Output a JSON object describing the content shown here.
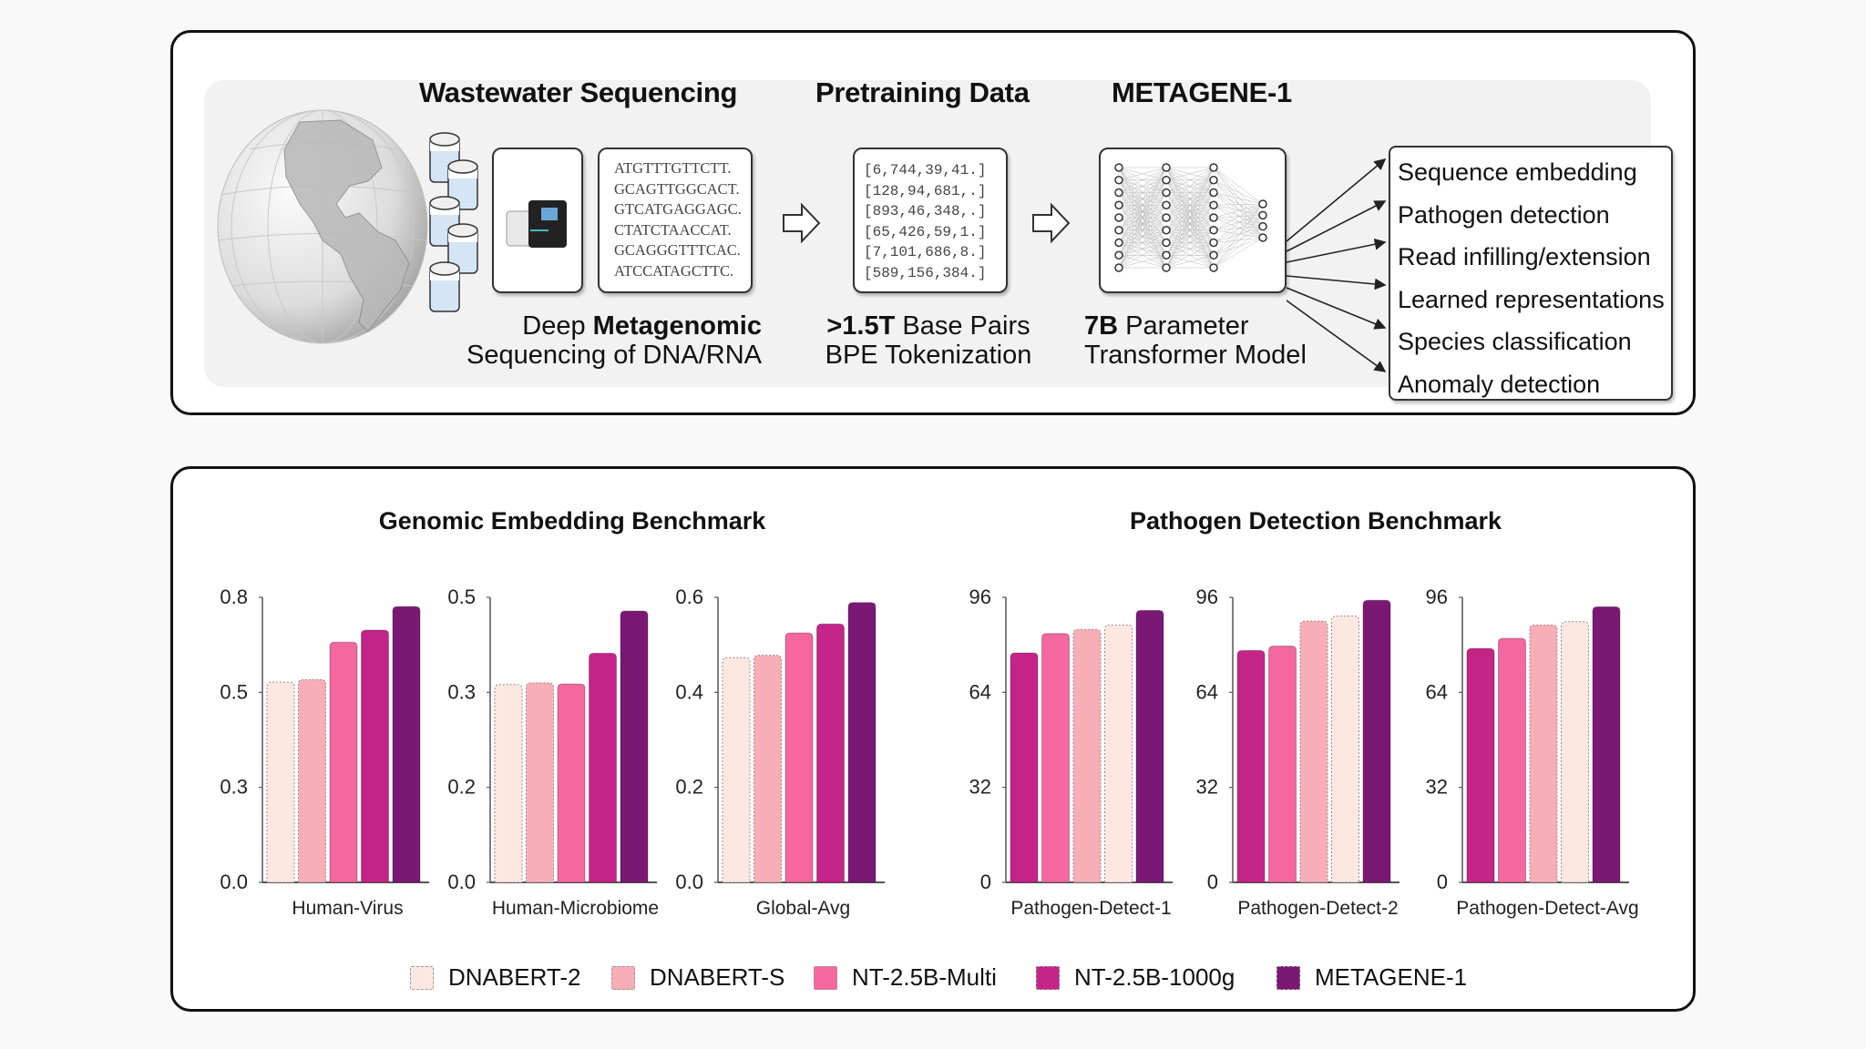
{
  "pipeline": {
    "stage1": {
      "title": "Wastewater Sequencing",
      "caption_bold": "Metagenomic",
      "caption_pre": "Deep ",
      "caption_line2": "Sequencing of DNA/RNA",
      "sequences": [
        "ATGTTTGTTCTT.",
        "GCAGTTGGCACT.",
        "GTCATGAGGAGC.",
        "CTATCTAACCAT.",
        "GCAGGGTTTCAC.",
        "ATCCATAGCTTC."
      ],
      "icons": [
        "globe-icon",
        "sample-tube-icon",
        "sequencer-machine-icon"
      ]
    },
    "stage2": {
      "title": "Pretraining Data",
      "caption_bold": ">1.5T",
      "caption_rest": " Base Pairs",
      "caption_line2": "BPE Tokenization",
      "tokens": [
        "[6,744,39,41.]",
        "[128,94,681,.]",
        "[893,46,348,.]",
        "[65,426,59,1.]",
        "[7,101,686,8.]",
        "[589,156,384.]"
      ]
    },
    "stage3": {
      "title": "METAGENE-1",
      "caption_bold": "7B",
      "caption_rest": " Parameter",
      "caption_line2": "Transformer Model",
      "icon": "neural-network-icon"
    },
    "outputs": [
      "Sequence embedding",
      "Pathogen detection",
      "Read infilling/extension",
      "Learned representations",
      "Species classification",
      "Anomaly detection"
    ]
  },
  "colors": {
    "DNABERT-2": "#FDE8E1",
    "DNABERT-S": "#F7AEB7",
    "NT-2.5B-Multi": "#F4679F",
    "NT-2.5B-1000g": "#C42487",
    "METAGENE-1": "#7A1874"
  },
  "chart_data": [
    {
      "type": "bar",
      "group_title": "Genomic Embedding Benchmark",
      "xlabel": "Human-Virus",
      "ylim": [
        0,
        0.8
      ],
      "yticks": [
        "0.0",
        "0.3",
        "0.5",
        "0.8"
      ],
      "series": [
        {
          "name": "DNABERT-2",
          "value": 0.562
        },
        {
          "name": "DNABERT-S",
          "value": 0.569
        },
        {
          "name": "NT-2.5B-Multi",
          "value": 0.674
        },
        {
          "name": "NT-2.5B-1000g",
          "value": 0.708
        },
        {
          "name": "METAGENE-1",
          "value": 0.774
        }
      ]
    },
    {
      "type": "bar",
      "group_title": "Genomic Embedding Benchmark",
      "xlabel": "Human-Microbiome",
      "ylim": [
        0,
        0.5
      ],
      "yticks": [
        "0.0",
        "0.2",
        "0.3",
        "0.5"
      ],
      "series": [
        {
          "name": "DNABERT-2",
          "value": 0.347
        },
        {
          "name": "DNABERT-S",
          "value": 0.35
        },
        {
          "name": "NT-2.5B-Multi",
          "value": 0.348
        },
        {
          "name": "NT-2.5B-1000g",
          "value": 0.402
        },
        {
          "name": "METAGENE-1",
          "value": 0.476
        }
      ]
    },
    {
      "type": "bar",
      "group_title": "Genomic Embedding Benchmark",
      "xlabel": "Global-Avg",
      "ylim": [
        0,
        0.6
      ],
      "yticks": [
        "0.0",
        "0.2",
        "0.4",
        "0.6"
      ],
      "series": [
        {
          "name": "DNABERT-2",
          "value": 0.473
        },
        {
          "name": "DNABERT-S",
          "value": 0.478
        },
        {
          "name": "NT-2.5B-Multi",
          "value": 0.525
        },
        {
          "name": "NT-2.5B-1000g",
          "value": 0.544
        },
        {
          "name": "METAGENE-1",
          "value": 0.589
        }
      ]
    },
    {
      "type": "bar",
      "group_title": "Pathogen Detection Benchmark",
      "xlabel": "Pathogen-Detect-1",
      "ylim": [
        0,
        96
      ],
      "yticks": [
        "0",
        "32",
        "64",
        "96"
      ],
      "series": [
        {
          "name": "NT-2.5B-1000g",
          "value": 77.3
        },
        {
          "name": "NT-2.5B-Multi",
          "value": 83.8
        },
        {
          "name": "DNABERT-S",
          "value": 85.2
        },
        {
          "name": "DNABERT-2",
          "value": 86.7
        },
        {
          "name": "METAGENE-1",
          "value": 91.6
        }
      ]
    },
    {
      "type": "bar",
      "group_title": "Pathogen Detection Benchmark",
      "xlabel": "Pathogen-Detect-2",
      "ylim": [
        0,
        96
      ],
      "yticks": [
        "0",
        "32",
        "64",
        "96"
      ],
      "series": [
        {
          "name": "NT-2.5B-1000g",
          "value": 78.1
        },
        {
          "name": "NT-2.5B-Multi",
          "value": 79.6
        },
        {
          "name": "DNABERT-S",
          "value": 88.0
        },
        {
          "name": "DNABERT-2",
          "value": 89.7
        },
        {
          "name": "METAGENE-1",
          "value": 95.0
        }
      ]
    },
    {
      "type": "bar",
      "group_title": "Pathogen Detection Benchmark",
      "xlabel": "Pathogen-Detect-Avg",
      "ylim": [
        0,
        96
      ],
      "yticks": [
        "0",
        "32",
        "64",
        "96"
      ],
      "series": [
        {
          "name": "NT-2.5B-1000g",
          "value": 78.8
        },
        {
          "name": "NT-2.5B-Multi",
          "value": 82.2
        },
        {
          "name": "DNABERT-S",
          "value": 86.7
        },
        {
          "name": "DNABERT-2",
          "value": 87.8
        },
        {
          "name": "METAGENE-1",
          "value": 92.8
        }
      ]
    }
  ],
  "chart_titles": {
    "left": "Genomic Embedding Benchmark",
    "right": "Pathogen Detection Benchmark"
  },
  "legend": [
    {
      "name": "DNABERT-2"
    },
    {
      "name": "DNABERT-S"
    },
    {
      "name": "NT-2.5B-Multi"
    },
    {
      "name": "NT-2.5B-1000g"
    },
    {
      "name": "METAGENE-1"
    }
  ]
}
